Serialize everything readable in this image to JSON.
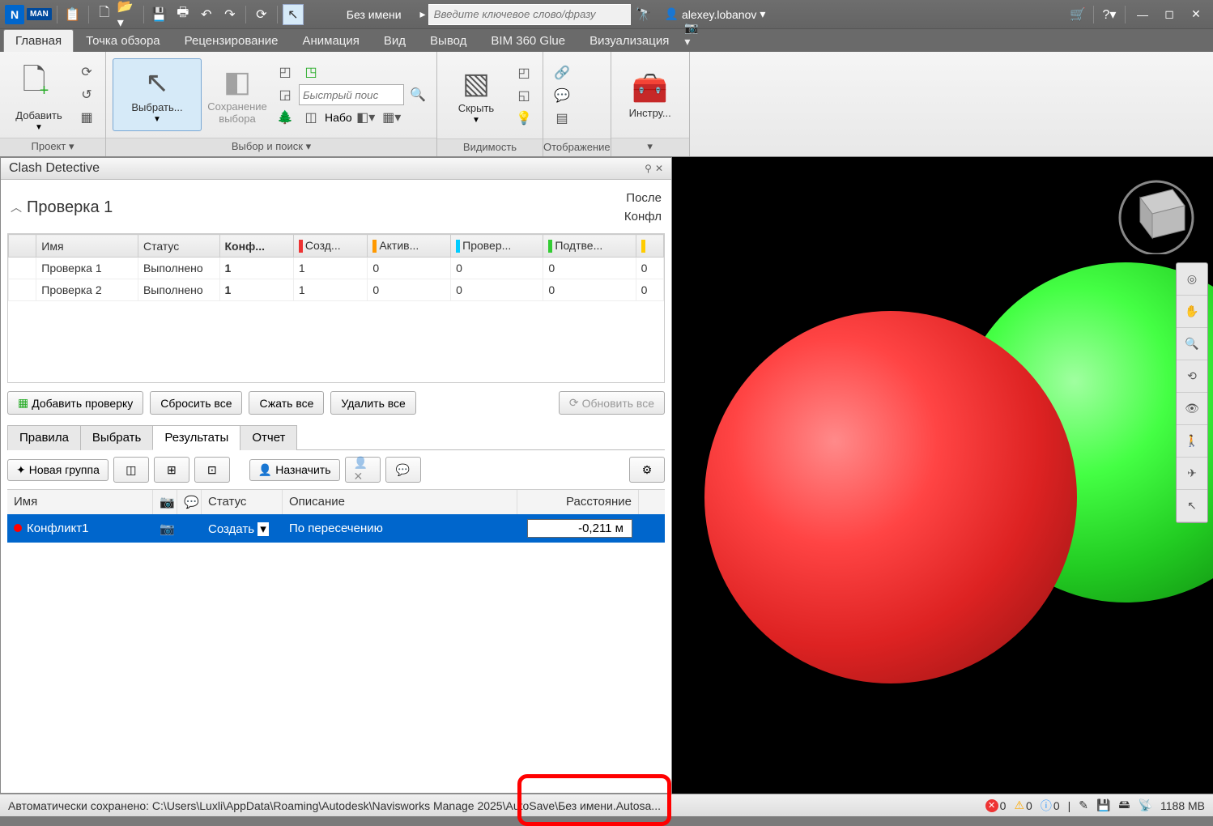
{
  "titlebar": {
    "app_initial": "N",
    "app_badge": "MAN",
    "doc_title": "Без имени",
    "search_placeholder": "Введите ключевое слово/фразу",
    "user": "alexey.lobanov"
  },
  "ribbon_tabs": {
    "main": "Главная",
    "viewpoint": "Точка обзора",
    "review": "Рецензирование",
    "animation": "Анимация",
    "view": "Вид",
    "output": "Вывод",
    "bim": "BIM 360 Glue",
    "visual": "Визуализация"
  },
  "ribbon": {
    "add": "Добавить",
    "project": "Проект ▾",
    "select": "Выбрать...",
    "save_sel": "Сохранение\nвыбора",
    "quick_find_ph": "Быстрый поис",
    "sets_label": "Набо",
    "group_select": "Выбор и поиск ▾",
    "hide": "Скрыть",
    "group_vis": "Видимость",
    "group_display": "Отображение",
    "tools": "Инстру..."
  },
  "clash": {
    "panel_title": "Clash Detective",
    "check_name": "Проверка 1",
    "right1": "После",
    "right2": "Конфл",
    "headers": {
      "name": "Имя",
      "status": "Статус",
      "conf": "Конф...",
      "created": "Созд...",
      "active": "Актив...",
      "reviewed": "Провер...",
      "approved": "Подтве..."
    },
    "rows": [
      {
        "name": "Проверка 1",
        "status": "Выполнено",
        "conf": "1",
        "created": "1",
        "active": "0",
        "reviewed": "0",
        "approved": "0",
        "res": "0"
      },
      {
        "name": "Проверка 2",
        "status": "Выполнено",
        "conf": "1",
        "created": "1",
        "active": "0",
        "reviewed": "0",
        "approved": "0",
        "res": "0"
      }
    ],
    "btn_add": "Добавить проверку",
    "btn_reset": "Сбросить все",
    "btn_compact": "Сжать все",
    "btn_delete": "Удалить все",
    "btn_update": "Обновить все",
    "subtabs": {
      "rules": "Правила",
      "select": "Выбрать",
      "results": "Результаты",
      "report": "Отчет"
    },
    "btn_newgroup": "Новая группа",
    "btn_assign": "Назначить",
    "res_headers": {
      "name": "Имя",
      "status": "Статус",
      "desc": "Описание",
      "dist": "Расстояние"
    },
    "result": {
      "name": "Конфликт1",
      "status": "Создать",
      "desc": "По пересечению",
      "dist": "-0,211 м"
    }
  },
  "statusbar": {
    "msg": "Автоматически сохранено: C:\\Users\\Luxli\\AppData\\Roaming\\Autodesk\\Navisworks Manage 2025\\AutoSave\\Без имени.Autosa...",
    "err": "0",
    "warn": "0",
    "info": "0",
    "mem": "1188 MB"
  }
}
